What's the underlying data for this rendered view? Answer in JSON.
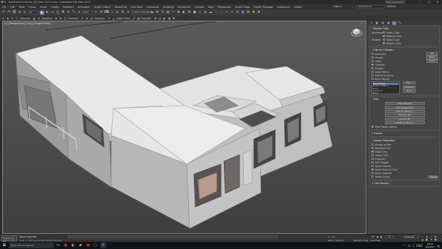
{
  "window": {
    "title": "3 - Apartment interior_2D_Max 2017.max - Autodesk 3ds Max 2017",
    "search_placeholder": "Type a keyword",
    "controls": [
      "–",
      "□",
      "✕"
    ]
  },
  "menu": {
    "items": [
      "File",
      "Edit",
      "Tools",
      "Group",
      "Views",
      "Create",
      "Modifiers",
      "Animation",
      "Graph Editors",
      "Rendering",
      "Civil View",
      "Customize",
      "Scripting",
      "Interactive",
      "Content",
      "Help",
      "Megascans",
      "Graph Forge",
      "Project Manager",
      "Substance",
      "Arnold"
    ],
    "sign_in": "Sign In",
    "workspace_label": "Workspaces:",
    "workspace_value": "Default"
  },
  "toolbar": {
    "undo": "↶",
    "redo": "↷",
    "filter_value": "All",
    "view_value": "View",
    "named_sel": "Create Selection Se",
    "small_text": "3"
  },
  "toolbar2": {
    "labels": [
      "Selection",
      "Modeling",
      "Freeform",
      "Selection",
      "Object Paint",
      "Populate"
    ]
  },
  "viewport": {
    "label": "[+] [Perspective] [Clay] [Edged Faces]"
  },
  "panel": {
    "tabs": [
      "+",
      "◧",
      "▥",
      "◉",
      "▭",
      "🔧"
    ],
    "display_color": {
      "head": "- Display Color",
      "wireframe_label": "Wireframe:",
      "object_color": "Object Color",
      "material_color": "Material Color",
      "shaded_label": "Shaded:",
      "object_color2": "Object Color",
      "material_color2": "Material Color"
    },
    "hide_by_category": {
      "head": "- Hide by Category",
      "items": [
        {
          "label": "Geometry",
          "checked": false,
          "button": "All"
        },
        {
          "label": "Shapes",
          "checked": false,
          "button": "None"
        },
        {
          "label": "Lights",
          "checked": false,
          "button": "Invert"
        },
        {
          "label": "Cameras",
          "checked": true,
          "button": ""
        },
        {
          "label": "Helpers",
          "checked": false,
          "button": ""
        },
        {
          "label": "Space Warps",
          "checked": false,
          "button": ""
        },
        {
          "label": "Particle Systems",
          "checked": false,
          "button": ""
        },
        {
          "label": "Bone Objects",
          "checked": false,
          "button": ""
        }
      ],
      "list": [
        "Bone Object",
        "IK Chain Object",
        "Point",
        "CAT Bone",
        "Bone"
      ],
      "add_btn": "Add...",
      "remove_btn": "Remove",
      "none_btn": "None"
    },
    "hide": {
      "head": "- Hide",
      "buttons": [
        "Hide Selected",
        "Hide Unselected",
        "Hide by Name...",
        "Hide by Hit",
        "Unhide All",
        "Unhide by Name..."
      ],
      "hide_frozen": "Hide Frozen Objects"
    },
    "freeze": {
      "head": "+ Freeze"
    },
    "display_properties": {
      "head": "- Display Properties",
      "items": [
        "Display as Box",
        "Backface Cull",
        "Edges Only",
        "Vertex Ticks",
        "Trajectory",
        "See-Through",
        "Ignore Extents",
        "Show Frozen in Gray",
        "Never Degrade",
        "Vertex Colors"
      ],
      "shaded_btn": "Shaded"
    },
    "link_display": {
      "head": "+ Link Display"
    }
  },
  "status": {
    "maxscript": "MAXScript Mi",
    "message": "None Selected",
    "hint": "Click or click-and-drag to select objects",
    "timeline": "0 / 100",
    "coords": "X:  Y:  Z:",
    "grid": "Grid = 10.0cm",
    "add_time_tag": "Add Time Tag",
    "frame": "0",
    "auto_key": "Auto Key",
    "set_key": "Set Key",
    "selected": "Selected",
    "key_filters": "Key Filters..."
  },
  "taskbar": {
    "search_placeholder": "Type here to search",
    "time": "09:52",
    "date": "6/4/2017",
    "lang": "ENG"
  },
  "colors": {
    "accent": "#5b7fa8",
    "viewport_bg_top": "#5a5a5a",
    "panel_bg": "#444444",
    "building_roof": "#e6e6e6",
    "building_wall": "#bdbdbd"
  }
}
